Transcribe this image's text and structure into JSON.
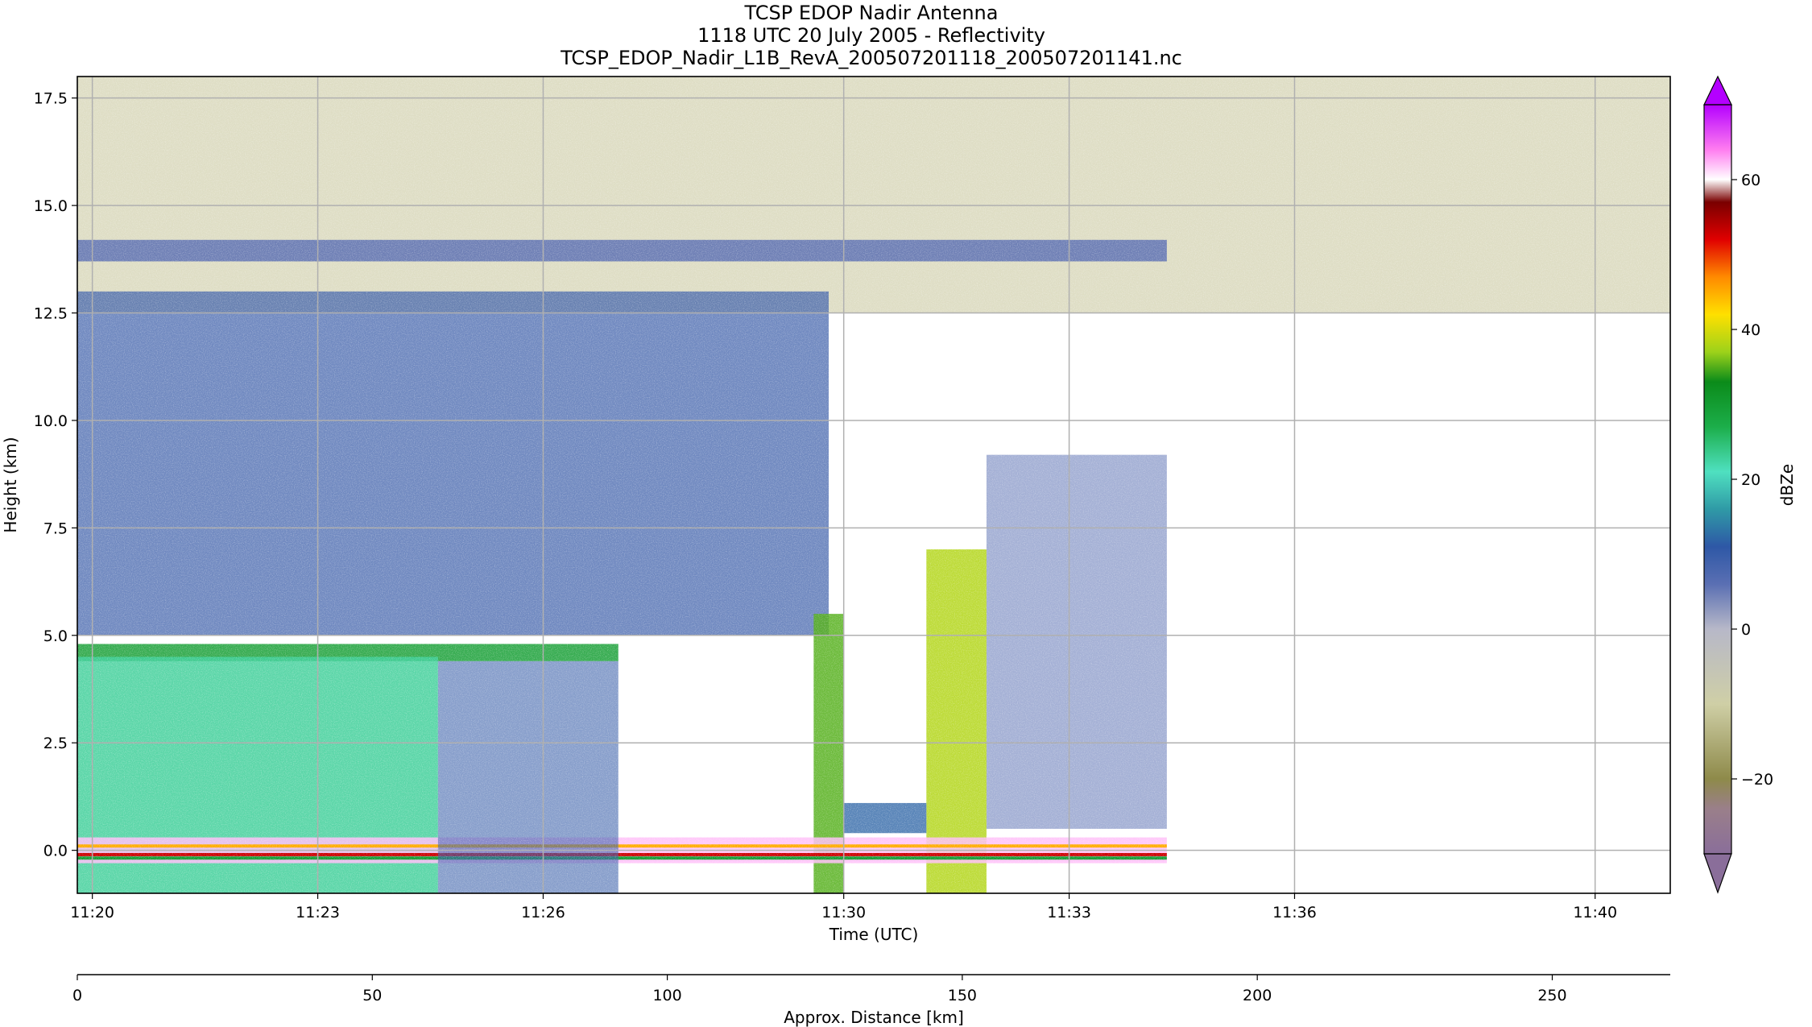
{
  "chart_data": {
    "type": "heatmap",
    "title": [
      "TCSP EDOP Nadir Antenna",
      "1118 UTC 20 July 2005 - Reflectivity",
      "TCSP_EDOP_Nadir_L1B_RevA_200507201118_200507201141.nc"
    ],
    "xlabel": "Time (UTC)",
    "ylabel": "Height (km)",
    "x_minutes_since_1118": [
      1.8,
      23.0
    ],
    "xticks": [
      {
        "min": 2,
        "label": "11:20"
      },
      {
        "min": 5,
        "label": "11:23"
      },
      {
        "min": 8,
        "label": "11:26"
      },
      {
        "min": 12,
        "label": "11:30"
      },
      {
        "min": 15,
        "label": "11:33"
      },
      {
        "min": 18,
        "label": "11:36"
      },
      {
        "min": 22,
        "label": "11:40"
      }
    ],
    "ylim": [
      -1.0,
      18.0
    ],
    "yticks": [
      {
        "v": 0.0,
        "label": "0.0"
      },
      {
        "v": 2.5,
        "label": "2.5"
      },
      {
        "v": 5.0,
        "label": "5.0"
      },
      {
        "v": 7.5,
        "label": "7.5"
      },
      {
        "v": 10.0,
        "label": "10.0"
      },
      {
        "v": 12.5,
        "label": "12.5"
      },
      {
        "v": 15.0,
        "label": "15.0"
      },
      {
        "v": 17.5,
        "label": "17.5"
      }
    ],
    "grid": true,
    "secondary_xaxis": {
      "label": "Approx. Distance [km]",
      "xlim": [
        0,
        270
      ],
      "ticks": [
        {
          "v": 0,
          "label": "0"
        },
        {
          "v": 50,
          "label": "50"
        },
        {
          "v": 100,
          "label": "100"
        },
        {
          "v": 150,
          "label": "150"
        },
        {
          "v": 200,
          "label": "200"
        },
        {
          "v": 250,
          "label": "250"
        }
      ]
    },
    "colorbar": {
      "label": "dBZe",
      "range": [
        -30,
        70
      ],
      "ticks": [
        {
          "v": -20,
          "label": "−20"
        },
        {
          "v": 0,
          "label": "0"
        },
        {
          "v": 20,
          "label": "20"
        },
        {
          "v": 40,
          "label": "40"
        },
        {
          "v": 60,
          "label": "60"
        }
      ],
      "stops": [
        {
          "v": -30,
          "color": "#8a6e9a"
        },
        {
          "v": -24,
          "color": "#9a7f8a"
        },
        {
          "v": -20,
          "color": "#8e8a4a"
        },
        {
          "v": -10,
          "color": "#cfcfa6"
        },
        {
          "v": 0,
          "color": "#b7b8c8"
        },
        {
          "v": 6,
          "color": "#5a6fb3"
        },
        {
          "v": 11,
          "color": "#2e58a6"
        },
        {
          "v": 16,
          "color": "#2f9aa6"
        },
        {
          "v": 21,
          "color": "#4fe0c0"
        },
        {
          "v": 27,
          "color": "#1cae4a"
        },
        {
          "v": 33,
          "color": "#0b8b1a"
        },
        {
          "v": 37,
          "color": "#9dd21a"
        },
        {
          "v": 42,
          "color": "#ffe000"
        },
        {
          "v": 47,
          "color": "#ff8a00"
        },
        {
          "v": 52,
          "color": "#e00000"
        },
        {
          "v": 57,
          "color": "#7a0000"
        },
        {
          "v": 60,
          "color": "#ffffff"
        },
        {
          "v": 64,
          "color": "#ff7df0"
        },
        {
          "v": 70,
          "color": "#b400ff"
        }
      ],
      "extend": "both"
    },
    "regions": [
      {
        "feature": "upper-level noise",
        "x": [
          1.8,
          23.0
        ],
        "y": [
          12.5,
          18.0
        ],
        "dbz": -12
      },
      {
        "feature": "flight level echo",
        "x": [
          1.8,
          16.3
        ],
        "y": [
          13.7,
          14.2
        ],
        "dbz": 6
      },
      {
        "feature": "stratiform anvil",
        "x": [
          1.8,
          11.8
        ],
        "y": [
          5.0,
          13.0
        ],
        "dbz": 9
      },
      {
        "feature": "bright band",
        "x": [
          1.8,
          9.0
        ],
        "y": [
          4.4,
          4.8
        ],
        "dbz": 30
      },
      {
        "feature": "stratiform rain",
        "x": [
          1.8,
          6.6
        ],
        "y": [
          -1.0,
          4.5
        ],
        "dbz": 23
      },
      {
        "feature": "convective core 1",
        "x": [
          11.6,
          12.0
        ],
        "y": [
          -1.0,
          5.5
        ],
        "dbz": 35
      },
      {
        "feature": "convective core 2",
        "x": [
          13.1,
          13.9
        ],
        "y": [
          -1.0,
          7.0
        ],
        "dbz": 38
      },
      {
        "feature": "surface return",
        "x": [
          1.8,
          16.3
        ],
        "y": [
          -0.3,
          0.3
        ],
        "dbz": 62
      }
    ]
  }
}
